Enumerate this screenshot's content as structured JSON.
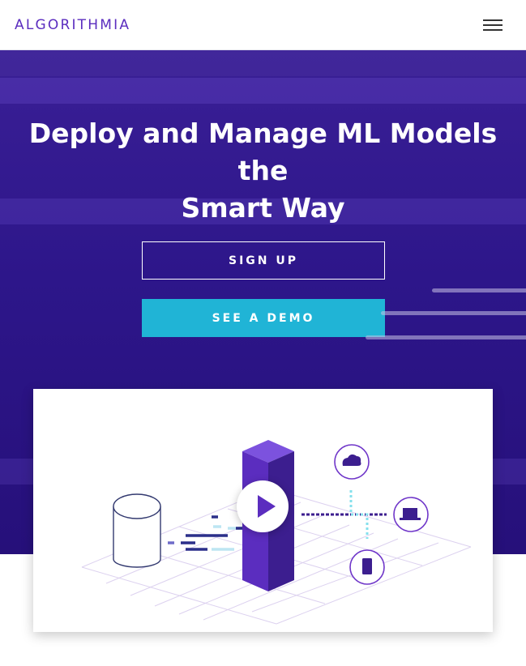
{
  "header": {
    "logo_text": "ALGORITHMIA",
    "menu_icon": "hamburger-menu-icon"
  },
  "hero": {
    "title_line1": "Deploy and Manage ML Models the",
    "title_line2": "Smart Way",
    "signup_label": "SIGN UP",
    "demo_label": "SEE A DEMO"
  },
  "video": {
    "play_icon": "play-icon",
    "illustration_icons": [
      "database-icon",
      "cloud-icon",
      "laptop-icon",
      "phone-icon"
    ]
  },
  "colors": {
    "brand_purple": "#5b2dbf",
    "hero_bg": "#2d168a",
    "accent_cyan": "#20b4d6"
  }
}
